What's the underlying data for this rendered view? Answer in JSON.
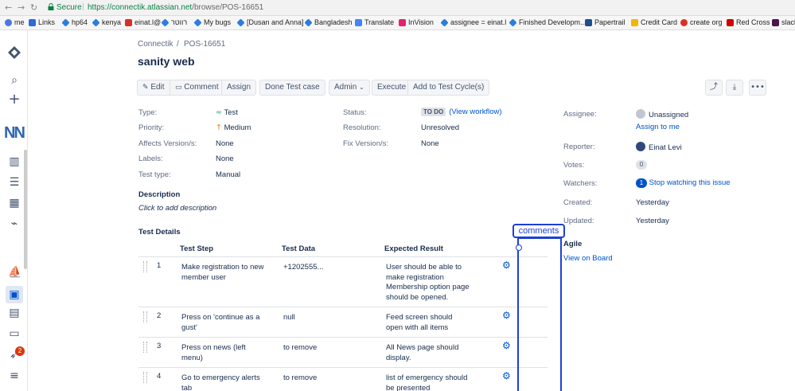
{
  "browser": {
    "secure_label": "Secure",
    "url_host": "https://connectik.atlassian.net",
    "url_path": "/browse/POS-16651",
    "bookmarks": [
      "me",
      "Links",
      "hp64",
      "kenya",
      "einat.l@",
      "רווטר",
      "My bugs",
      "[Dusan and Anna]",
      "Bangladesh",
      "Translate",
      "InVision",
      "assignee = einat.l",
      "Finished Developm...",
      "Papertrail",
      "Credit Card",
      "create org",
      "Red Cross",
      "slack"
    ]
  },
  "sidebar": {
    "notification_count": "2"
  },
  "breadcrumb": {
    "project": "Connectik",
    "separator": "/",
    "issue_key": "POS-16651"
  },
  "issue": {
    "title": "sanity web"
  },
  "toolbar": {
    "edit": "Edit",
    "comment": "Comment",
    "assign": "Assign",
    "done_test_case": "Done Test case",
    "admin": "Admin",
    "execute": "Execute",
    "add_to_test_cycle": "Add to Test Cycle(s)"
  },
  "details": {
    "type_label": "Type:",
    "type_value": "Test",
    "priority_label": "Priority:",
    "priority_value": "Medium",
    "affects_label": "Affects Version/s:",
    "affects_value": "None",
    "labels_label": "Labels:",
    "labels_value": "None",
    "testtype_label": "Test type:",
    "testtype_value": "Manual",
    "status_label": "Status:",
    "status_value": "TO DO",
    "view_workflow": "(View workflow)",
    "resolution_label": "Resolution:",
    "resolution_value": "Unresolved",
    "fix_label": "Fix Version/s:",
    "fix_value": "None"
  },
  "people": {
    "assignee_label": "Assignee:",
    "assignee_value": "Unassigned",
    "assign_to_me": "Assign to me",
    "reporter_label": "Reporter:",
    "reporter_value": "Einat Levi",
    "votes_label": "Votes:",
    "votes_value": "0",
    "watchers_label": "Watchers:",
    "watchers_value": "1",
    "stop_watching": "Stop watching this issue",
    "created_label": "Created:",
    "created_value": "Yesterday",
    "updated_label": "Updated:",
    "updated_value": "Yesterday",
    "agile_label": "Agile",
    "view_on_board": "View on Board"
  },
  "description": {
    "heading": "Description",
    "placeholder": "Click to add description"
  },
  "test_details": {
    "heading": "Test Details",
    "columns": [
      "Test Step",
      "Test Data",
      "Expected Result"
    ],
    "rows": [
      {
        "num": "1",
        "step": [
          "Make registration to new",
          "member user"
        ],
        "data": "+1202555...",
        "result": [
          "User should be able to",
          "make registration",
          "Membership option page",
          "should be opened."
        ]
      },
      {
        "num": "2",
        "step": [
          "Press on 'continue as a",
          "gust'"
        ],
        "data": "null",
        "result": [
          "Feed screen should",
          "open with all items"
        ]
      },
      {
        "num": "3",
        "step": [
          "Press on news (left",
          "menu)"
        ],
        "data": "to remove",
        "result": [
          "All News page should",
          "display."
        ]
      },
      {
        "num": "4",
        "step": [
          "Go to emergency alerts",
          "tab"
        ],
        "data": "to remove",
        "result": [
          "list of emergency should",
          "be presented"
        ]
      }
    ]
  },
  "annotation": {
    "label": "comments"
  }
}
